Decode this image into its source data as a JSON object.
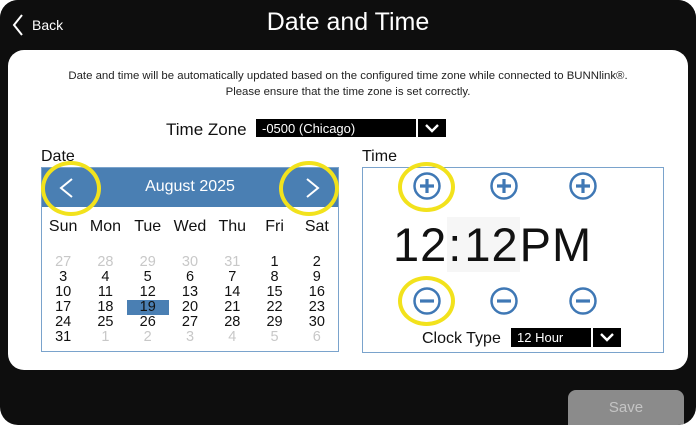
{
  "header": {
    "back_label": "Back",
    "title": "Date and Time"
  },
  "notice": {
    "line1": "Date and time will be automatically updated based on the configured time zone while connected to BUNNlink®.",
    "line2": "Please ensure that the time zone is set correctly."
  },
  "timezone": {
    "label": "Time Zone",
    "value": "-0500 (Chicago)"
  },
  "date": {
    "label": "Date",
    "month": "August 2025",
    "weekdays": [
      "Sun",
      "Mon",
      "Tue",
      "Wed",
      "Thu",
      "Fri",
      "Sat"
    ],
    "weeks": [
      [
        "27",
        "28",
        "29",
        "30",
        "31",
        "1",
        "2"
      ],
      [
        "3",
        "4",
        "5",
        "6",
        "7",
        "8",
        "9"
      ],
      [
        "10",
        "11",
        "12",
        "13",
        "14",
        "15",
        "16"
      ],
      [
        "17",
        "18",
        "19",
        "20",
        "21",
        "22",
        "23"
      ],
      [
        "24",
        "25",
        "26",
        "27",
        "28",
        "29",
        "30"
      ],
      [
        "31",
        "1",
        "2",
        "3",
        "4",
        "5",
        "6"
      ]
    ],
    "selected": "19"
  },
  "time": {
    "label": "Time",
    "hour": "12",
    "separator": ":",
    "minute": "12",
    "period": "PM",
    "clock_type_label": "Clock Type",
    "clock_type_value": "12 Hour"
  },
  "footer": {
    "save_label": "Save"
  },
  "colors": {
    "accent": "#4a7fb3",
    "highlight": "#f2e21c",
    "background": "#0e0e0e"
  },
  "icons": [
    "chevron-left-icon",
    "chevron-down-icon",
    "plus-circle-icon",
    "minus-circle-icon"
  ]
}
